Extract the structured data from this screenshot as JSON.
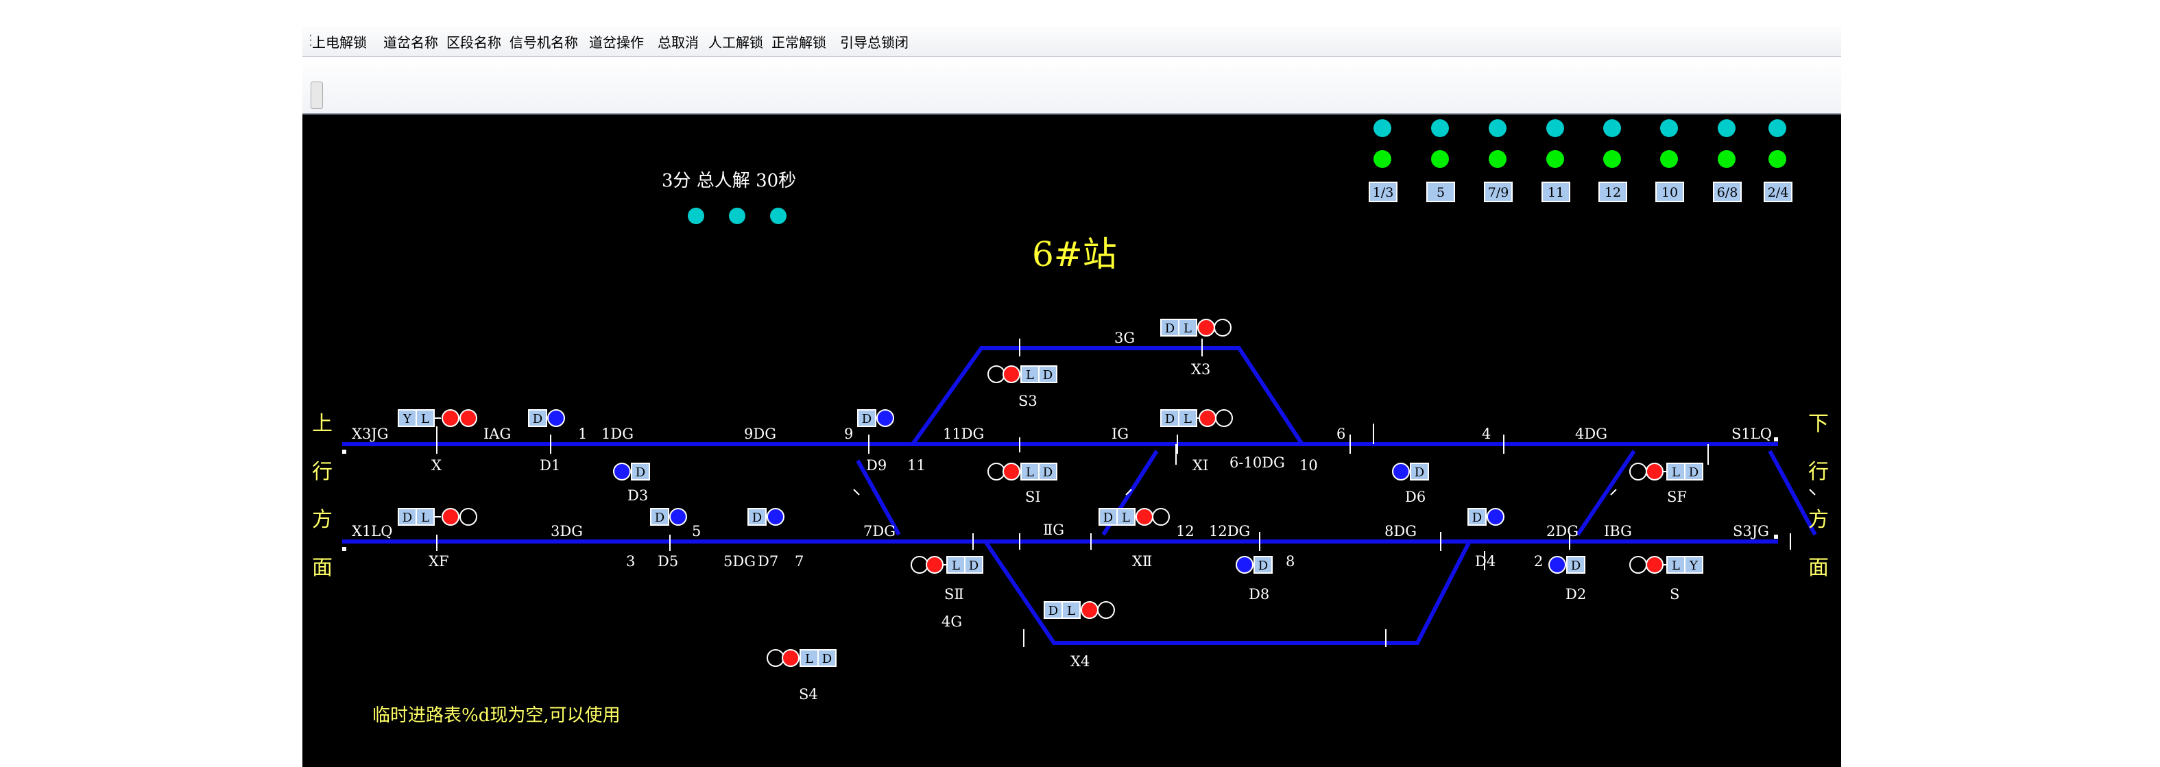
{
  "menu": {
    "items": [
      "上电解锁",
      "道岔名称",
      "区段名称",
      "信号机名称",
      "道岔操作",
      "总取消",
      "人工解锁",
      "正常解锁",
      "引导总锁闭"
    ]
  },
  "station": {
    "title": "6#站",
    "timer_label": "3分 总人解 30秒",
    "status_message": "临时进路表%d现为空,可以使用",
    "left_direction": [
      "上",
      "行",
      "方",
      "面"
    ],
    "right_direction": [
      "下",
      "行",
      "方",
      "面"
    ]
  },
  "indicators": {
    "labels": [
      "1/3",
      "5",
      "7/9",
      "11",
      "12",
      "10",
      "6/8",
      "2/4"
    ],
    "colors": {
      "top": "#00cccc",
      "bottom": "#00ee00"
    }
  },
  "track_labels": {
    "x3jg": "X3JG",
    "iag": "IAG",
    "one": "1",
    "1dg": "1DG",
    "9dg": "9DG",
    "nine": "9",
    "eleven_dg": "11DG",
    "ig": "IG",
    "six": "6",
    "four": "4",
    "4dg": "4DG",
    "s1lq": "S1LQ",
    "x": "X",
    "d1": "D1",
    "d3": "D3",
    "d9": "D9",
    "eleven": "11",
    "si": "SI",
    "xi": "XI",
    "six_10dg": "6-10DG",
    "ten": "10",
    "d6": "D6",
    "sf": "SF",
    "x1lq": "X1LQ",
    "3dg": "3DG",
    "five": "5",
    "7dg": "7DG",
    "iig": "ⅡG",
    "twelve": "12",
    "12dg": "12DG",
    "8dg": "8DG",
    "2dg": "2DG",
    "ibg": "IBG",
    "s3jg": "S3JG",
    "xf": "XF",
    "three": "3",
    "d5": "D5",
    "5dg": "5DG",
    "d7": "D7",
    "seven": "7",
    "sii": "SⅡ",
    "xii": "XⅡ",
    "d8": "D8",
    "eight": "8",
    "d4": "D4",
    "two": "2",
    "d2": "D2",
    "s": "S",
    "3g": "3G",
    "x3": "X3",
    "s3": "S3",
    "4g": "4G",
    "x4": "X4",
    "s4": "S4"
  },
  "box_letters": {
    "d": "D",
    "l": "L",
    "y": "Y"
  },
  "colors": {
    "track": "#1010e6",
    "signal_red": "#ff1a1a",
    "signal_blue": "#1a1aff",
    "box_fill": "#a8c8ee"
  }
}
